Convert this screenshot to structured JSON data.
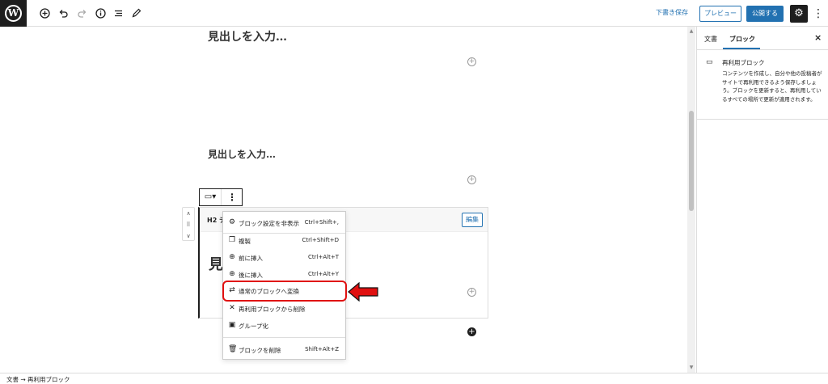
{
  "topbar": {
    "logo": "W",
    "icons": [
      "add-icon",
      "undo-icon",
      "redo-icon",
      "info-icon",
      "list-view-icon",
      "edit-icon"
    ],
    "save_draft": "下書き保存",
    "preview": "プレビュー",
    "publish": "公開する",
    "settings_icon": "⚙",
    "more_icon": "⋮"
  },
  "canvas": {
    "heading1": "見出しを入力…",
    "heading2": "見出しを入力…",
    "plus": "+"
  },
  "block_toolbar": {
    "type_icon": "▭▾",
    "more_icon": "⋮"
  },
  "mover": {
    "up": "∧",
    "drag": "⠿",
    "down": "∨"
  },
  "reusable": {
    "title": "H2 テ",
    "edit": "編集",
    "big_text": "見"
  },
  "menu": {
    "items": [
      {
        "icon": "⚙",
        "label": "ブロック設定を非表示",
        "shortcut": "Ctrl+Shift+,"
      },
      {
        "icon": "❐",
        "label": "複製",
        "shortcut": "Ctrl+Shift+D"
      },
      {
        "icon": "⊕",
        "label": "前に挿入",
        "shortcut": "Ctrl+Alt+T"
      },
      {
        "icon": "⊕",
        "label": "後に挿入",
        "shortcut": "Ctrl+Alt+Y"
      },
      {
        "icon": "⇄",
        "label": "通常のブロックへ変換",
        "shortcut": ""
      },
      {
        "icon": "✕",
        "label": "再利用ブロックから削除",
        "shortcut": ""
      },
      {
        "icon": "▣",
        "label": "グループ化",
        "shortcut": ""
      },
      {
        "icon": "🗑",
        "label": "ブロックを削除",
        "shortcut": "Shift+Alt+Z"
      }
    ]
  },
  "sidebar": {
    "tab_document": "文書",
    "tab_block": "ブロック",
    "close": "×",
    "card_icon": "▭",
    "card_title": "再利用ブロック",
    "card_desc": "コンテンツを作成し、自分や他の投稿者がサイトで再利用できるよう保存しましょう。ブロックを更新すると、再利用しているすべての場所で更新が適用されます。"
  },
  "footer": {
    "breadcrumb": "文書 → 再利用ブロック"
  },
  "colors": {
    "accent": "#2271b1",
    "highlight": "#e01010",
    "dark": "#1e1e1e"
  }
}
